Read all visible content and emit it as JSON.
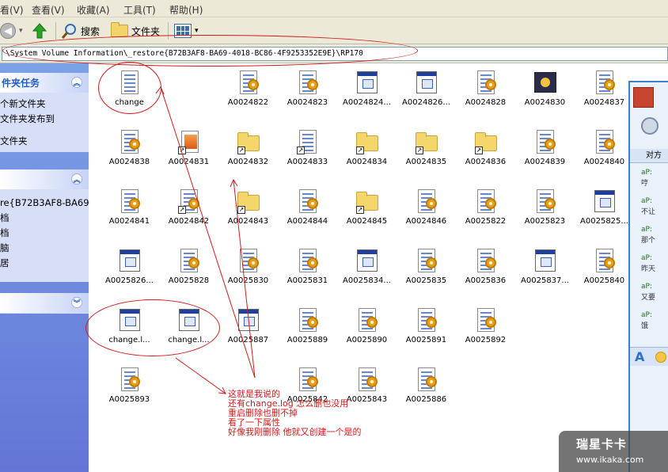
{
  "menu": {
    "items": [
      "看(V)",
      "查看(V)",
      "收藏(A)",
      "工具(T)",
      "帮助(H)"
    ]
  },
  "toolbar": {
    "search_label": "搜索",
    "folders_label": "文件夹"
  },
  "address": {
    "path": "\\System Volume Information\\_restore{B72B3AF8-BA69-4018-BC86-4F9253352E9E}\\RP170"
  },
  "taskpane": {
    "panel1": {
      "title": "件夹任务",
      "items": [
        "个新文件夹",
        "文件夹发布到",
        "文件夹"
      ]
    },
    "panel2": {
      "items": [
        "re{B72B3AF8-BA69",
        "档",
        "档",
        "脑",
        "居"
      ]
    }
  },
  "files": [
    "change",
    "A0024822",
    "A0024823",
    "A0024824...",
    "A0024826...",
    "A0024828",
    "A0024830",
    "A0024837",
    "A0024838",
    "A0024831",
    "A0024832",
    "A0024833",
    "A0024834",
    "A0024835",
    "A0024836",
    "A0024839",
    "A0024840",
    "A0024841",
    "A0024842",
    "A0024843",
    "A0024844",
    "A0024845",
    "A0024846",
    "A0025822",
    "A0025823",
    "A0025825...",
    "A0025826...",
    "A0025828",
    "A0025830",
    "A0025831",
    "A0025834...",
    "A0025835",
    "A0025836",
    "A0025837...",
    "A0025840",
    "change.l...",
    "change.l...",
    "A0025887",
    "A0025889",
    "A0025890",
    "A0025891",
    "A0025892",
    "A0025893",
    "A0025842",
    "A0025843",
    "A0025886"
  ],
  "annotation": {
    "lines": [
      "这就是我说的",
      "还有change.log 怎么删也没用",
      "重启删除也删不掉",
      "看了一下属性",
      "好像我刚删除 他就又创建一个是的"
    ]
  },
  "chat": {
    "header": "对方",
    "messages": [
      "aP:",
      "哼",
      "aP:",
      "不让",
      "aP:",
      "那个",
      "aP:",
      "昨天",
      "aP:",
      "又要",
      "aP:",
      "饿"
    ]
  },
  "watermark": {
    "brand": "瑞星卡卡",
    "url": "www.ikaka.com"
  },
  "colors": {
    "annotation": "#d21b1b",
    "taskpane": "#6375d6",
    "chrome": "#ece9d8"
  }
}
